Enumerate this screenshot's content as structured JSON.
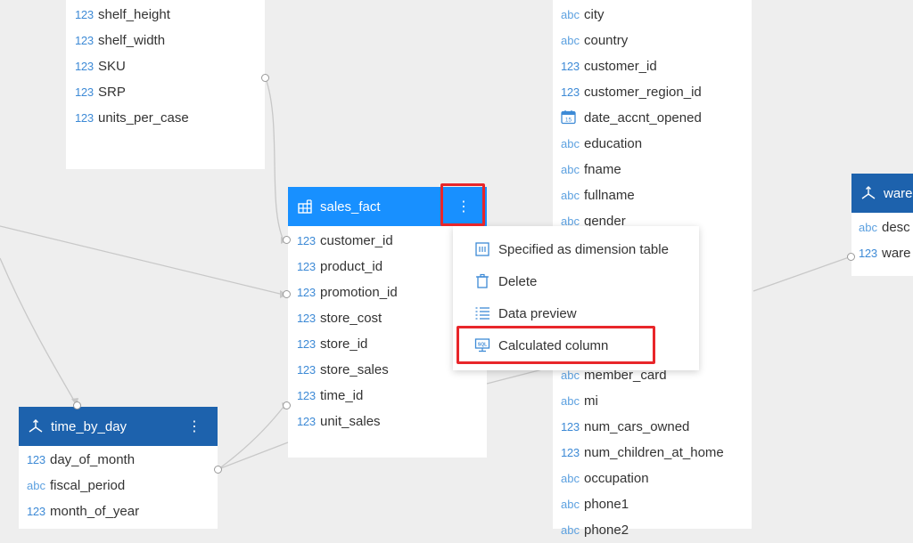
{
  "product_table": {
    "columns": [
      {
        "type": "123",
        "name": "shelf_height"
      },
      {
        "type": "123",
        "name": "shelf_width"
      },
      {
        "type": "123",
        "name": "SKU"
      },
      {
        "type": "123",
        "name": "SRP"
      },
      {
        "type": "123",
        "name": "units_per_case"
      }
    ]
  },
  "customer_table": {
    "columns": [
      {
        "type": "abc",
        "name": "city"
      },
      {
        "type": "abc",
        "name": "country"
      },
      {
        "type": "123",
        "name": "customer_id"
      },
      {
        "type": "123",
        "name": "customer_region_id"
      },
      {
        "type": "date",
        "name": "date_accnt_opened"
      },
      {
        "type": "abc",
        "name": "education"
      },
      {
        "type": "abc",
        "name": "fname"
      },
      {
        "type": "abc",
        "name": "fullname"
      },
      {
        "type": "abc",
        "name": "gender"
      }
    ],
    "columns_lower": [
      {
        "type": "abc",
        "name": "member_card"
      },
      {
        "type": "abc",
        "name": "mi"
      },
      {
        "type": "123",
        "name": "num_cars_owned"
      },
      {
        "type": "123",
        "name": "num_children_at_home"
      },
      {
        "type": "abc",
        "name": "occupation"
      },
      {
        "type": "abc",
        "name": "phone1"
      },
      {
        "type": "abc",
        "name": "phone2"
      }
    ]
  },
  "sales_fact": {
    "title": "sales_fact",
    "more": "⋮",
    "columns": [
      {
        "type": "123",
        "name": "customer_id"
      },
      {
        "type": "123",
        "name": "product_id"
      },
      {
        "type": "123",
        "name": "promotion_id"
      },
      {
        "type": "123",
        "name": "store_cost"
      },
      {
        "type": "123",
        "name": "store_id"
      },
      {
        "type": "123",
        "name": "store_sales"
      },
      {
        "type": "123",
        "name": "time_id"
      },
      {
        "type": "123",
        "name": "unit_sales"
      }
    ]
  },
  "time_by_day": {
    "title": "time_by_day",
    "more": "⋮",
    "columns": [
      {
        "type": "123",
        "name": "day_of_month"
      },
      {
        "type": "abc",
        "name": "fiscal_period"
      },
      {
        "type": "123",
        "name": "month_of_year"
      }
    ]
  },
  "warehouse": {
    "title": "ware",
    "columns": [
      {
        "type": "abc",
        "name": "desc"
      },
      {
        "type": "123",
        "name": "ware"
      }
    ]
  },
  "context_menu": {
    "items": [
      {
        "label": "Specified as dimension table",
        "icon": "dimension-table-icon"
      },
      {
        "label": "Delete",
        "icon": "trash-icon"
      },
      {
        "label": "Data preview",
        "icon": "list-preview-icon"
      },
      {
        "label": "Calculated column",
        "icon": "calculated-column-icon"
      }
    ]
  },
  "colors": {
    "fact_header": "#1890ff",
    "dimension_header": "#1d62ad",
    "highlight": "#e8262a",
    "type_tag": "#3d8ad6",
    "canvas": "#eeeeee"
  }
}
